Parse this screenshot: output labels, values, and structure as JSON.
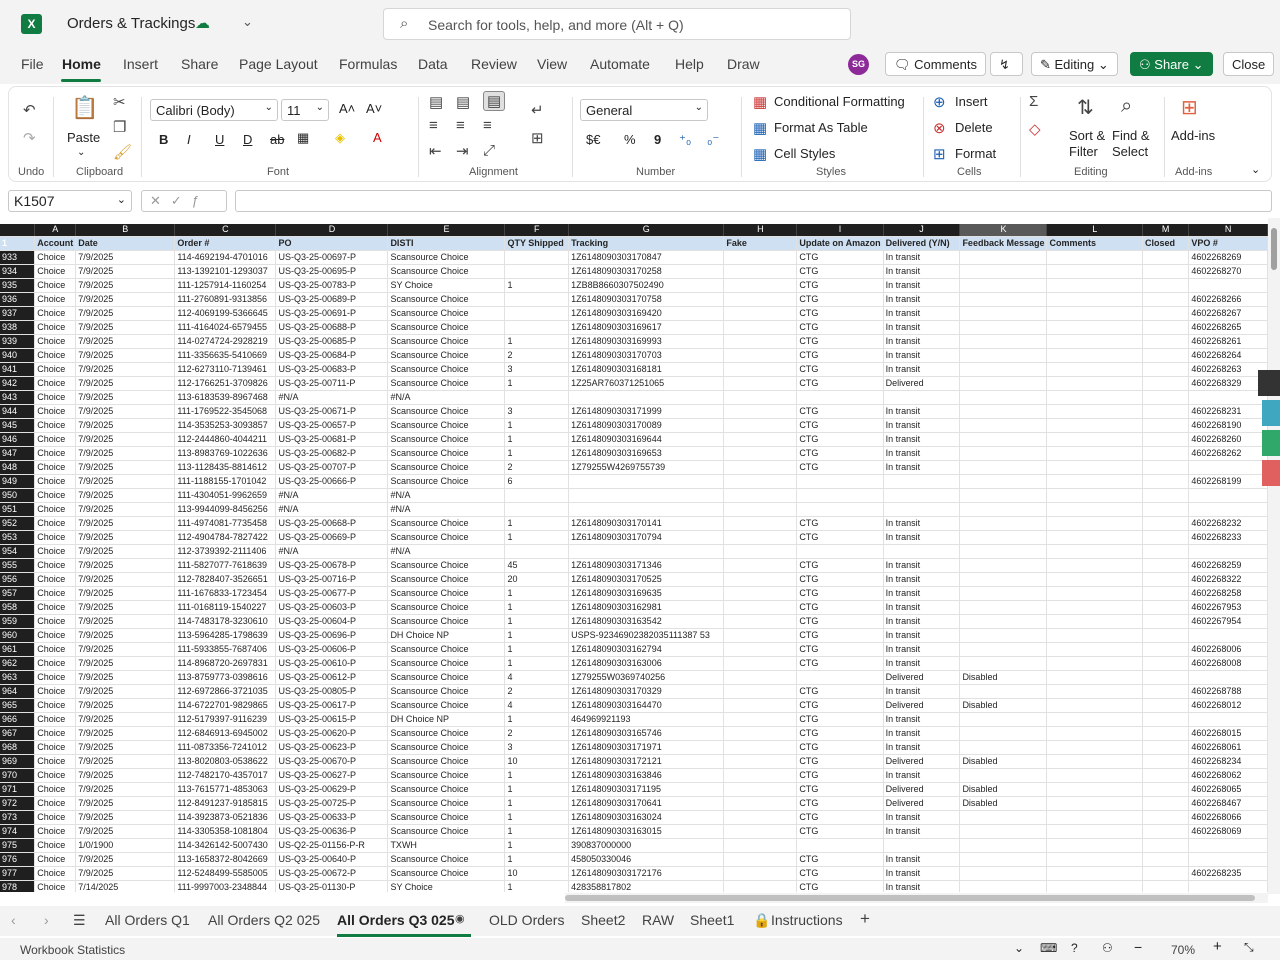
{
  "window": {
    "title": "Orders & Trackings"
  },
  "search": {
    "placeholder": "Search for tools, help, and more (Alt + Q)"
  },
  "menu": {
    "items": [
      "File",
      "Home",
      "Insert",
      "Share",
      "Page Layout",
      "Formulas",
      "Data",
      "Review",
      "View",
      "Automate",
      "Help",
      "Draw"
    ],
    "active": "Home"
  },
  "user": {
    "initials": "SG"
  },
  "topbuttons": {
    "comments": "Comments",
    "editing": "Editing",
    "share": "Share",
    "close": "Close"
  },
  "ribbon": {
    "undo_label": "Undo",
    "paste_label": "Paste",
    "clipboard_label": "Clipboard",
    "font_name": "Calibri (Body)",
    "font_size": "11",
    "font_label": "Font",
    "alignment_label": "Alignment",
    "number_format": "General",
    "number_label": "Number",
    "cond_format": "Conditional Formatting",
    "format_table": "Format As Table",
    "cell_styles": "Cell Styles",
    "styles_label": "Styles",
    "insert": "Insert",
    "delete": "Delete",
    "format": "Format",
    "cells_label": "Cells",
    "sort_filter_1": "Sort &",
    "sort_filter_2": "Filter",
    "find_select_1": "Find &",
    "find_select_2": "Select",
    "editing_label": "Editing",
    "addins": "Add-ins",
    "addins_label": "Add-ins",
    "currency": "$€",
    "percent": "%",
    "comma": "9"
  },
  "formula": {
    "namebox": "K1507",
    "value": ""
  },
  "grid": {
    "columns": [
      "A",
      "B",
      "C",
      "D",
      "E",
      "F",
      "G",
      "H",
      "I",
      "J",
      "K",
      "L",
      "M",
      "N"
    ],
    "selected_column": "K",
    "headers": [
      "Account",
      "Date",
      "Order #",
      "PO",
      "DISTI",
      "QTY Shipped",
      "Tracking",
      "Fake",
      "Update on Amazon",
      "Delivered (Y/N)",
      "Feedback Message",
      "Comments",
      "Closed",
      "VPO #"
    ],
    "header_row_num": "1",
    "rows": [
      [
        "933",
        "Choice",
        "7/9/2025",
        "114-4692194-4701016",
        "US-Q3-25-00697-P",
        "Scansource Choice",
        "",
        "1Z6148090303170847",
        "",
        "CTG",
        "In transit",
        "",
        "",
        "",
        "4602268269"
      ],
      [
        "934",
        "Choice",
        "7/9/2025",
        "113-1392101-1293037",
        "US-Q3-25-00695-P",
        "Scansource Choice",
        "",
        "1Z6148090303170258",
        "",
        "CTG",
        "In transit",
        "",
        "",
        "",
        "4602268270"
      ],
      [
        "935",
        "Choice",
        "7/9/2025",
        "111-1257914-1160254",
        "US-Q3-25-00783-P",
        "SY Choice",
        "1",
        "1ZB8B8660307502490",
        "",
        "CTG",
        "In transit",
        "",
        "",
        "",
        ""
      ],
      [
        "936",
        "Choice",
        "7/9/2025",
        "111-2760891-9313856",
        "US-Q3-25-00689-P",
        "Scansource Choice",
        "",
        "1Z6148090303170758",
        "",
        "CTG",
        "In transit",
        "",
        "",
        "",
        "4602268266"
      ],
      [
        "937",
        "Choice",
        "7/9/2025",
        "112-4069199-5366645",
        "US-Q3-25-00691-P",
        "Scansource Choice",
        "",
        "1Z6148090303169420",
        "",
        "CTG",
        "In transit",
        "",
        "",
        "",
        "4602268267"
      ],
      [
        "938",
        "Choice",
        "7/9/2025",
        "111-4164024-6579455",
        "US-Q3-25-00688-P",
        "Scansource Choice",
        "",
        "1Z6148090303169617",
        "",
        "CTG",
        "In transit",
        "",
        "",
        "",
        "4602268265"
      ],
      [
        "939",
        "Choice",
        "7/9/2025",
        "114-0274724-2928219",
        "US-Q3-25-00685-P",
        "Scansource Choice",
        "1",
        "1Z6148090303169993",
        "",
        "CTG",
        "In transit",
        "",
        "",
        "",
        "4602268261"
      ],
      [
        "940",
        "Choice",
        "7/9/2025",
        "111-3356635-5410669",
        "US-Q3-25-00684-P",
        "Scansource Choice",
        "2",
        "1Z6148090303170703",
        "",
        "CTG",
        "In transit",
        "",
        "",
        "",
        "4602268264"
      ],
      [
        "941",
        "Choice",
        "7/9/2025",
        "112-6273110-7139461",
        "US-Q3-25-00683-P",
        "Scansource Choice",
        "3",
        "1Z6148090303168181",
        "",
        "CTG",
        "In transit",
        "",
        "",
        "",
        "4602268263"
      ],
      [
        "942",
        "Choice",
        "7/9/2025",
        "112-1766251-3709826",
        "US-Q3-25-00711-P",
        "Scansource Choice",
        "1",
        "1Z25AR760371251065",
        "",
        "CTG",
        "Delivered",
        "",
        "",
        "",
        "4602268329"
      ],
      [
        "943",
        "Choice",
        "7/9/2025",
        "113-6183539-8967468",
        "#N/A",
        "#N/A",
        "",
        "",
        "",
        "",
        "",
        "",
        "",
        "",
        ""
      ],
      [
        "944",
        "Choice",
        "7/9/2025",
        "111-1769522-3545068",
        "US-Q3-25-00671-P",
        "Scansource Choice",
        "3",
        "1Z6148090303171999",
        "",
        "CTG",
        "In transit",
        "",
        "",
        "",
        "4602268231"
      ],
      [
        "945",
        "Choice",
        "7/9/2025",
        "114-3535253-3093857",
        "US-Q3-25-00657-P",
        "Scansource Choice",
        "1",
        "1Z6148090303170089",
        "",
        "CTG",
        "In transit",
        "",
        "",
        "",
        "4602268190"
      ],
      [
        "946",
        "Choice",
        "7/9/2025",
        "112-2444860-4044211",
        "US-Q3-25-00681-P",
        "Scansource Choice",
        "1",
        "1Z6148090303169644",
        "",
        "CTG",
        "In transit",
        "",
        "",
        "",
        "4602268260"
      ],
      [
        "947",
        "Choice",
        "7/9/2025",
        "113-8983769-1022636",
        "US-Q3-25-00682-P",
        "Scansource Choice",
        "1",
        "1Z6148090303169653",
        "",
        "CTG",
        "In transit",
        "",
        "",
        "",
        "4602268262"
      ],
      [
        "948",
        "Choice",
        "7/9/2025",
        "113-1128435-8814612",
        "US-Q3-25-00707-P",
        "Scansource Choice",
        "2",
        "1Z79255W4269755739",
        "",
        "CTG",
        "In transit",
        "",
        "",
        "",
        ""
      ],
      [
        "949",
        "Choice",
        "7/9/2025",
        "111-1188155-1701042",
        "US-Q3-25-00666-P",
        "Scansource Choice",
        "6",
        "",
        "",
        "",
        "",
        "",
        "",
        "",
        "4602268199"
      ],
      [
        "950",
        "Choice",
        "7/9/2025",
        "111-4304051-9962659",
        "#N/A",
        "#N/A",
        "",
        "",
        "",
        "",
        "",
        "",
        "",
        "",
        ""
      ],
      [
        "951",
        "Choice",
        "7/9/2025",
        "113-9944099-8456256",
        "#N/A",
        "#N/A",
        "",
        "",
        "",
        "",
        "",
        "",
        "",
        "",
        ""
      ],
      [
        "952",
        "Choice",
        "7/9/2025",
        "111-4974081-7735458",
        "US-Q3-25-00668-P",
        "Scansource Choice",
        "1",
        "1Z6148090303170141",
        "",
        "CTG",
        "In transit",
        "",
        "",
        "",
        "4602268232"
      ],
      [
        "953",
        "Choice",
        "7/9/2025",
        "112-4904784-7827422",
        "US-Q3-25-00669-P",
        "Scansource Choice",
        "1",
        "1Z6148090303170794",
        "",
        "CTG",
        "In transit",
        "",
        "",
        "",
        "4602268233"
      ],
      [
        "954",
        "Choice",
        "7/9/2025",
        "112-3739392-2111406",
        "#N/A",
        "#N/A",
        "",
        "",
        "",
        "",
        "",
        "",
        "",
        "",
        ""
      ],
      [
        "955",
        "Choice",
        "7/9/2025",
        "111-5827077-7618639",
        "US-Q3-25-00678-P",
        "Scansource Choice",
        "45",
        "1Z6148090303171346",
        "",
        "CTG",
        "In transit",
        "",
        "",
        "",
        "4602268259"
      ],
      [
        "956",
        "Choice",
        "7/9/2025",
        "112-7828407-3526651",
        "US-Q3-25-00716-P",
        "Scansource Choice",
        "20",
        "1Z6148090303170525",
        "",
        "CTG",
        "In transit",
        "",
        "",
        "",
        "4602268322"
      ],
      [
        "957",
        "Choice",
        "7/9/2025",
        "111-1676833-1723454",
        "US-Q3-25-00677-P",
        "Scansource Choice",
        "1",
        "1Z6148090303169635",
        "",
        "CTG",
        "In transit",
        "",
        "",
        "",
        "4602268258"
      ],
      [
        "958",
        "Choice",
        "7/9/2025",
        "111-0168119-1540227",
        "US-Q3-25-00603-P",
        "Scansource Choice",
        "1",
        "1Z6148090303162981",
        "",
        "CTG",
        "In transit",
        "",
        "",
        "",
        "4602267953"
      ],
      [
        "959",
        "Choice",
        "7/9/2025",
        "114-7483178-3230610",
        "US-Q3-25-00604-P",
        "Scansource Choice",
        "1",
        "1Z6148090303163542",
        "",
        "CTG",
        "In transit",
        "",
        "",
        "",
        "4602267954"
      ],
      [
        "960",
        "Choice",
        "7/9/2025",
        "113-5964285-1798639",
        "US-Q3-25-00696-P",
        "DH Choice NP",
        "1",
        "USPS-92346902382035111387 53",
        "",
        "CTG",
        "In transit",
        "",
        "",
        "",
        ""
      ],
      [
        "961",
        "Choice",
        "7/9/2025",
        "111-5933855-7687406",
        "US-Q3-25-00606-P",
        "Scansource Choice",
        "1",
        "1Z6148090303162794",
        "",
        "CTG",
        "In transit",
        "",
        "",
        "",
        "4602268006"
      ],
      [
        "962",
        "Choice",
        "7/9/2025",
        "114-8968720-2697831",
        "US-Q3-25-00610-P",
        "Scansource Choice",
        "1",
        "1Z6148090303163006",
        "",
        "CTG",
        "In transit",
        "",
        "",
        "",
        "4602268008"
      ],
      [
        "963",
        "Choice",
        "7/9/2025",
        "113-8759773-0398616",
        "US-Q3-25-00612-P",
        "Scansource Choice",
        "4",
        "1Z79255W0369740256",
        "",
        "",
        "Delivered",
        "Disabled",
        "",
        "",
        ""
      ],
      [
        "964",
        "Choice",
        "7/9/2025",
        "112-6972866-3721035",
        "US-Q3-25-00805-P",
        "Scansource Choice",
        "2",
        "1Z6148090303170329",
        "",
        "CTG",
        "In transit",
        "",
        "",
        "",
        "4602268788"
      ],
      [
        "965",
        "Choice",
        "7/9/2025",
        "114-6722701-9829865",
        "US-Q3-25-00617-P",
        "Scansource Choice",
        "4",
        "1Z6148090303164470",
        "",
        "CTG",
        "Delivered",
        "Disabled",
        "",
        "",
        "4602268012"
      ],
      [
        "966",
        "Choice",
        "7/9/2025",
        "112-5179397-9116239",
        "US-Q3-25-00615-P",
        "DH Choice NP",
        "1",
        "464969921193",
        "",
        "CTG",
        "In transit",
        "",
        "",
        "",
        ""
      ],
      [
        "967",
        "Choice",
        "7/9/2025",
        "112-6846913-6945002",
        "US-Q3-25-00620-P",
        "Scansource Choice",
        "2",
        "1Z6148090303165746",
        "",
        "CTG",
        "In transit",
        "",
        "",
        "",
        "4602268015"
      ],
      [
        "968",
        "Choice",
        "7/9/2025",
        "111-0873356-7241012",
        "US-Q3-25-00623-P",
        "Scansource Choice",
        "3",
        "1Z6148090303171971",
        "",
        "CTG",
        "In transit",
        "",
        "",
        "",
        "4602268061"
      ],
      [
        "969",
        "Choice",
        "7/9/2025",
        "113-8020803-0538622",
        "US-Q3-25-00670-P",
        "Scansource Choice",
        "10",
        "1Z6148090303172121",
        "",
        "CTG",
        "Delivered",
        "Disabled",
        "",
        "",
        "4602268234"
      ],
      [
        "970",
        "Choice",
        "7/9/2025",
        "112-7482170-4357017",
        "US-Q3-25-00627-P",
        "Scansource Choice",
        "1",
        "1Z6148090303163846",
        "",
        "CTG",
        "In transit",
        "",
        "",
        "",
        "4602268062"
      ],
      [
        "971",
        "Choice",
        "7/9/2025",
        "113-7615771-4853063",
        "US-Q3-25-00629-P",
        "Scansource Choice",
        "1",
        "1Z6148090303171195",
        "",
        "CTG",
        "Delivered",
        "Disabled",
        "",
        "",
        "4602268065"
      ],
      [
        "972",
        "Choice",
        "7/9/2025",
        "112-8491237-9185815",
        "US-Q3-25-00725-P",
        "Scansource Choice",
        "1",
        "1Z6148090303170641",
        "",
        "CTG",
        "Delivered",
        "Disabled",
        "",
        "",
        "4602268467"
      ],
      [
        "973",
        "Choice",
        "7/9/2025",
        "114-3923873-0521836",
        "US-Q3-25-00633-P",
        "Scansource Choice",
        "1",
        "1Z6148090303163024",
        "",
        "CTG",
        "In transit",
        "",
        "",
        "",
        "4602268066"
      ],
      [
        "974",
        "Choice",
        "7/9/2025",
        "114-3305358-1081804",
        "US-Q3-25-00636-P",
        "Scansource Choice",
        "1",
        "1Z6148090303163015",
        "",
        "CTG",
        "In transit",
        "",
        "",
        "",
        "4602268069"
      ],
      [
        "975",
        "Choice",
        "1/0/1900",
        "114-3426142-5007430",
        "US-Q2-25-01156-P-R",
        "TXWH",
        "1",
        "390837000000",
        "",
        "",
        "",
        "",
        "",
        "",
        ""
      ],
      [
        "976",
        "Choice",
        "7/9/2025",
        "113-1658372-8042669",
        "US-Q3-25-00640-P",
        "Scansource Choice",
        "1",
        "458050330046",
        "",
        "CTG",
        "In transit",
        "",
        "",
        "",
        ""
      ],
      [
        "977",
        "Choice",
        "7/9/2025",
        "112-5248499-5585005",
        "US-Q3-25-00672-P",
        "Scansource Choice",
        "10",
        "1Z6148090303172176",
        "",
        "CTG",
        "In transit",
        "",
        "",
        "",
        "4602268235"
      ],
      [
        "978",
        "Choice",
        "7/14/2025",
        "111-9997003-2348844",
        "US-Q3-25-01130-P",
        "SY Choice",
        "1",
        "428358817802",
        "",
        "CTG",
        "In transit",
        "",
        "",
        "",
        ""
      ]
    ]
  },
  "sheets": {
    "tabs": [
      "All Orders Q1",
      "All Orders Q2 025",
      "All Orders Q3 025",
      "OLD Orders",
      "Sheet2",
      "RAW",
      "Sheet1",
      "Instructions"
    ],
    "active": "All Orders Q3 025"
  },
  "status": {
    "left": "Workbook Statistics",
    "zoom": "70%"
  }
}
